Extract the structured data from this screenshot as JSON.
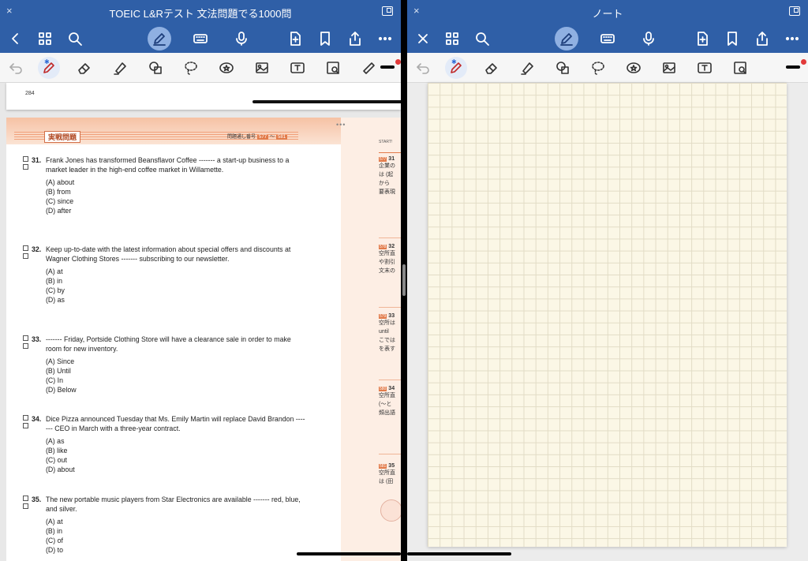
{
  "left_app": {
    "title": "TOEIC L&Rテスト 文法問題でる1000問",
    "close_glyph": "×",
    "nav_icons": [
      "back-icon",
      "grid-icon",
      "search-icon",
      "pen-mode-icon",
      "keyboard-icon",
      "microphone-icon",
      "add-page-icon",
      "bookmark-icon",
      "share-icon",
      "more-icon"
    ]
  },
  "right_app": {
    "title": "ノート",
    "close_glyph": "×",
    "nav_icons": [
      "close-icon",
      "grid-icon",
      "search-icon",
      "pen-mode-icon",
      "keyboard-icon",
      "microphone-icon",
      "add-page-icon",
      "bookmark-icon",
      "share-icon",
      "more-icon"
    ]
  },
  "toolbar": {
    "tools": [
      "undo-icon",
      "pen-icon",
      "eraser-icon",
      "highlighter-icon",
      "shapes-icon",
      "lasso-icon",
      "sticker-icon",
      "image-icon",
      "text-icon",
      "camera-icon",
      "ruler-icon"
    ],
    "colors": {
      "accent": "#2f5fa7",
      "pen": "#c02828",
      "dot": "#e23a3a"
    }
  },
  "document": {
    "prev_page_number": "284",
    "banner_label": "実戦問題",
    "banner_range_prefix": "問題通し番号",
    "banner_range_start": "577",
    "banner_range_end": "581",
    "banner_range_sep": "～",
    "questions": [
      {
        "number": "31.",
        "stem": "Frank Jones has transformed Beansflavor Coffee ------- a start-up business to a market leader in the high-end coffee market in Willamette.",
        "options": [
          "(A) about",
          "(B) from",
          "(C) since",
          "(D) after"
        ]
      },
      {
        "number": "32.",
        "stem": "Keep up-to-date with the latest information about special offers and discounts at Wagner Clothing Stores ------- subscribing to our newsletter.",
        "options": [
          "(A) at",
          "(B) in",
          "(C) by",
          "(D) as"
        ]
      },
      {
        "number": "33.",
        "stem": "------- Friday, Portside Clothing Store will have a clearance sale in order to make room for new inventory.",
        "options": [
          "(A) Since",
          "(B) Until",
          "(C) In",
          "(D) Below"
        ]
      },
      {
        "number": "34.",
        "stem": "Dice Pizza announced Tuesday that Ms. Emily Martin will replace David Brandon ------- CEO in March with a three-year contract.",
        "options": [
          "(A) as",
          "(B) like",
          "(C) out",
          "(D) about"
        ]
      },
      {
        "number": "35.",
        "stem": "The new portable music players from Star Electronics are available ------- red, blue, and silver.",
        "options": [
          "(A) at",
          "(B) in",
          "(C) of",
          "(D) to"
        ]
      }
    ],
    "side": {
      "start_label": "START!",
      "items": [
        {
          "tag": "577",
          "num": "31",
          "lines": [
            "企業の",
            "は (起",
            "から",
            "要表現"
          ]
        },
        {
          "tag": "578",
          "num": "32",
          "lines": [
            "空所直",
            "や割引",
            "文末の"
          ]
        },
        {
          "tag": "579",
          "num": "33",
          "lines": [
            "空所は",
            "until",
            "こでは",
            "を表す"
          ]
        },
        {
          "tag": "580",
          "num": "34",
          "lines": [
            "空所直",
            "(～と",
            "頻出語"
          ]
        },
        {
          "tag": "581",
          "num": "35",
          "lines": [
            "空所直",
            "は (田"
          ]
        }
      ]
    }
  }
}
